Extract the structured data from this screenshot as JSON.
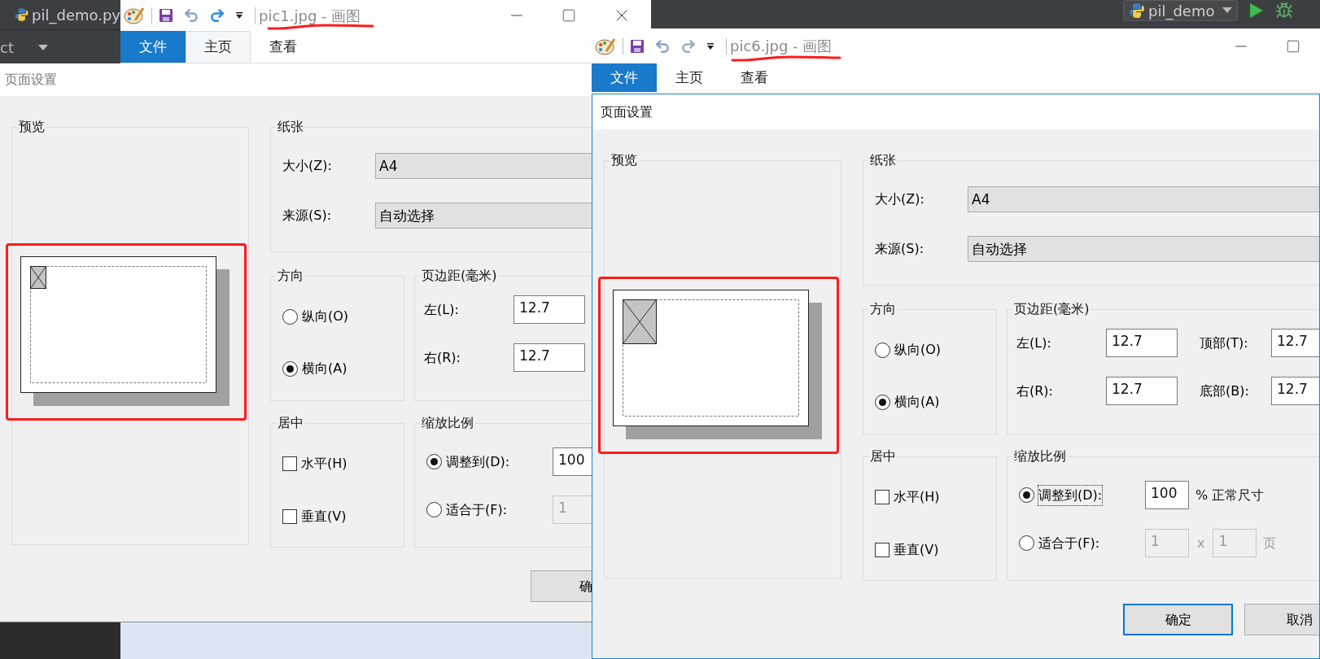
{
  "ide": {
    "file_tab": "pil_demo.py",
    "panel_label": "ct",
    "run_config": "pil_demo"
  },
  "windows": [
    {
      "title": "pic1.jpg - 画图",
      "active": false,
      "ribbon_tabs": [
        {
          "label": "文件",
          "kind": "file",
          "selected": false
        },
        {
          "label": "主页",
          "kind": "tab",
          "selected": true
        },
        {
          "label": "查看",
          "kind": "tab",
          "selected": false
        }
      ],
      "dialog": {
        "title": "页面设置",
        "preview_label": "预览",
        "paper": {
          "label": "纸张",
          "rows": [
            {
              "label": "大小(Z):",
              "value": "A4"
            },
            {
              "label": "来源(S):",
              "value": "自动选择"
            }
          ]
        },
        "orientation": {
          "label": "方向",
          "options": [
            {
              "label": "纵向(O)",
              "selected": false
            },
            {
              "label": "横向(A)",
              "selected": true
            }
          ]
        },
        "margins": {
          "label": "页边距(毫米)",
          "rows": [
            [
              {
                "label": "左(L):",
                "value": "12.7"
              }
            ],
            [
              {
                "label": "右(R):",
                "value": "12.7"
              }
            ]
          ]
        },
        "centering": {
          "label": "居中",
          "options": [
            {
              "label": "水平(H)",
              "checked": false
            },
            {
              "label": "垂直(V)",
              "checked": false
            }
          ]
        },
        "scaling": {
          "label": "缩放比例",
          "options": [
            {
              "label": "调整到(D):",
              "selected": true,
              "focused": false,
              "fields": [
                {
                  "value": "100",
                  "disabled": false
                }
              ]
            },
            {
              "label": "适合于(F):",
              "selected": false,
              "focused": false,
              "fields": [
                {
                  "value": "1",
                  "disabled": true
                }
              ]
            }
          ]
        },
        "buttons": [
          {
            "label": "确",
            "default": false
          }
        ]
      }
    },
    {
      "title": "pic6.jpg - 画图",
      "active": true,
      "ribbon_tabs": [
        {
          "label": "文件",
          "kind": "file",
          "selected": false
        },
        {
          "label": "主页",
          "kind": "tab",
          "selected": false
        },
        {
          "label": "查看",
          "kind": "tab",
          "selected": false
        }
      ],
      "dialog": {
        "title": "页面设置",
        "preview_label": "预览",
        "paper": {
          "label": "纸张",
          "rows": [
            {
              "label": "大小(Z):",
              "value": "A4"
            },
            {
              "label": "来源(S):",
              "value": "自动选择"
            }
          ]
        },
        "orientation": {
          "label": "方向",
          "options": [
            {
              "label": "纵向(O)",
              "selected": false
            },
            {
              "label": "横向(A)",
              "selected": true
            }
          ]
        },
        "margins": {
          "label": "页边距(毫米)",
          "rows": [
            [
              {
                "label": "左(L):",
                "value": "12.7"
              },
              {
                "label": "顶部(T):",
                "value": "12.7"
              }
            ],
            [
              {
                "label": "右(R):",
                "value": "12.7"
              },
              {
                "label": "底部(B):",
                "value": "12.7"
              }
            ]
          ]
        },
        "centering": {
          "label": "居中",
          "options": [
            {
              "label": "水平(H)",
              "checked": false
            },
            {
              "label": "垂直(V)",
              "checked": false
            }
          ]
        },
        "scaling": {
          "label": "缩放比例",
          "options": [
            {
              "label": "调整到(D):",
              "selected": true,
              "focused": true,
              "fields": [
                {
                  "value": "100",
                  "disabled": false
                }
              ],
              "suffix": "% 正常尺寸"
            },
            {
              "label": "适合于(F):",
              "selected": false,
              "focused": false,
              "fields": [
                {
                  "value": "1",
                  "disabled": true
                },
                {
                  "value": "1",
                  "disabled": true
                }
              ],
              "separator": "x",
              "suffix": "页"
            }
          ]
        },
        "buttons": [
          {
            "label": "确定",
            "default": true
          },
          {
            "label": "取消",
            "default": false
          }
        ]
      }
    }
  ]
}
